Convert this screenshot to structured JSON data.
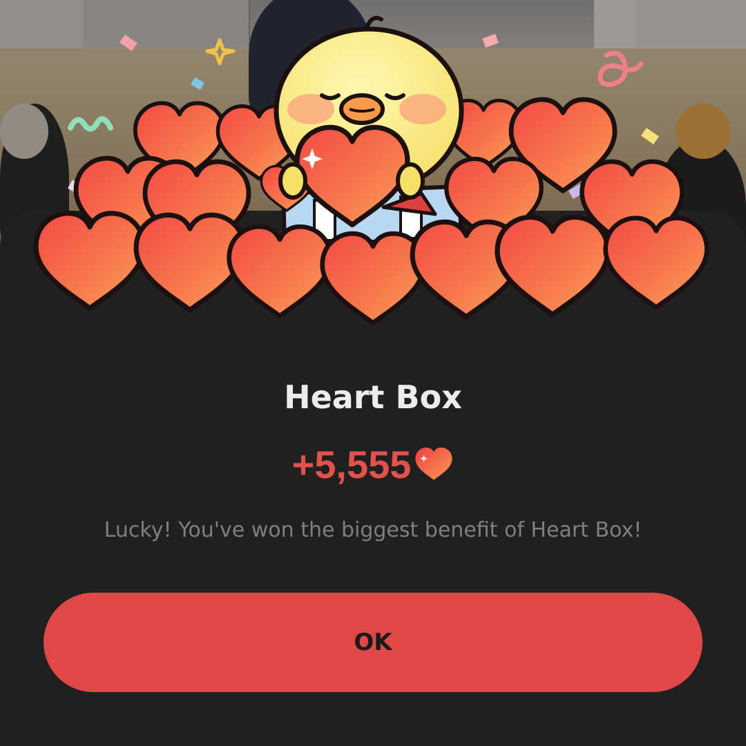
{
  "dialog": {
    "title": "Heart Box",
    "amount": "+5,555",
    "message": "Lucky! You've won the biggest benefit of Heart Box!",
    "ok_label": "OK"
  },
  "icons": {
    "amount_icon": "heart-icon",
    "mascot": "yellow-chick-mascot-holding-heart",
    "gift_box": "open-gift-box-icon"
  },
  "colors": {
    "sheet_background": "#202020",
    "accent_red": "#e04848",
    "amount_red": "#e2514b",
    "title_text": "#ececec",
    "message_text": "#7f7f7f"
  }
}
